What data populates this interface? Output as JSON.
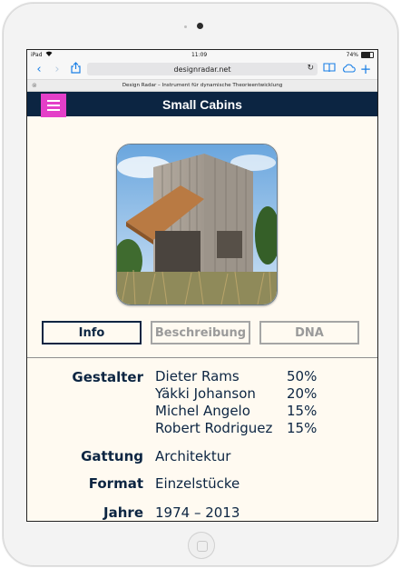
{
  "statusbar": {
    "device": "iPad",
    "wifi_icon": "wifi-icon",
    "time": "11:09",
    "battery_text": "74%",
    "battery_level": 0.74
  },
  "toolbar": {
    "back_icon": "chevron-left-icon",
    "forward_icon": "chevron-right-icon",
    "share_icon": "share-icon",
    "url": "designradar.net",
    "reload_icon": "reload-icon",
    "bookmarks_icon": "book-icon",
    "icloud_icon": "cloud-icon",
    "new_tab_icon": "plus-icon"
  },
  "tab": {
    "title": "Design Radar – Instrument für dynamische Theorieentwicklung"
  },
  "header": {
    "title": "Small Cabins",
    "accent_color": "#e43fc8",
    "bar_color": "#0c2542"
  },
  "tabs": [
    {
      "label": "Info",
      "active": true
    },
    {
      "label": "Beschreibung",
      "active": false
    },
    {
      "label": "DNA",
      "active": false
    }
  ],
  "info": {
    "designers_label": "Gestalter",
    "designers": [
      {
        "name": "Dieter Rams",
        "share": "50%"
      },
      {
        "name": "Yäkki Johanson",
        "share": "20%"
      },
      {
        "name": "Michel Angelo",
        "share": "15%"
      },
      {
        "name": "Robert Rodriguez",
        "share": "15%"
      }
    ],
    "genre_label": "Gattung",
    "genre": "Architektur",
    "format_label": "Format",
    "format": "Einzelstücke",
    "years_label": "Jahre",
    "years": "1974 – 2013"
  }
}
